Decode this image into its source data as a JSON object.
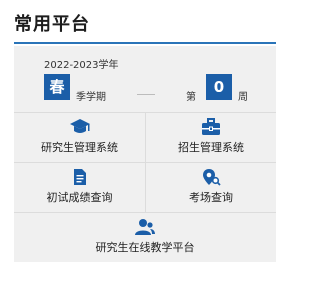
{
  "header": {
    "title": "常用平台"
  },
  "term": {
    "academic_year": "2022-2023学年",
    "season": "春",
    "season_label": "季学期",
    "week_prefix": "第",
    "week_number": "0",
    "week_suffix": "周"
  },
  "platforms": [
    {
      "label": "研究生管理系统",
      "icon": "graduation-cap-icon"
    },
    {
      "label": "招生管理系统",
      "icon": "briefcase-icon"
    },
    {
      "label": "初试成绩查询",
      "icon": "document-icon"
    },
    {
      "label": "考场查询",
      "icon": "location-search-icon"
    },
    {
      "label": "研究生在线教学平台",
      "icon": "user-group-icon"
    }
  ],
  "colors": {
    "accent": "#1b5ea8",
    "rule": "#2a74b8",
    "panel": "#f0f0f0"
  }
}
